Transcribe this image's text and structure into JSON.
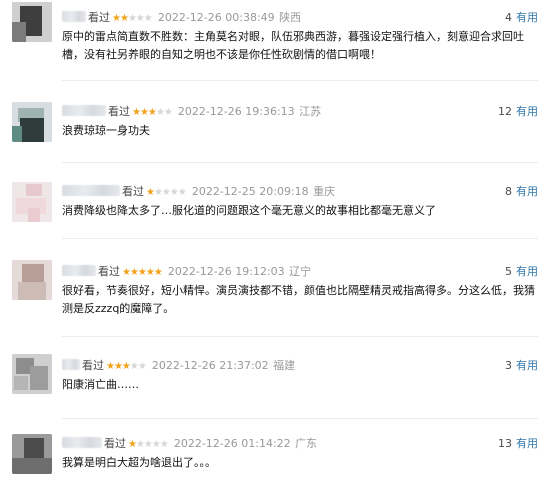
{
  "reviews": [
    {
      "watched": "看过",
      "stars": 2,
      "time": "2022-12-26 00:38:49",
      "location": "陕西",
      "useful_count": "4",
      "useful_label": "有用",
      "content": "原中的雷点简直数不胜数：主角莫名对眼，队伍邪典西游，暮强设定强行植入，刻意迎合求回吐槽，没有社另养眼的自知之明也不该是你任性砍剧情的借口啊喂！"
    },
    {
      "watched": "看过",
      "stars": 3,
      "time": "2022-12-26 19:36:13",
      "location": "江苏",
      "useful_count": "12",
      "useful_label": "有用",
      "content": "浪费琼琼一身功夫"
    },
    {
      "watched": "看过",
      "stars": 1,
      "time": "2022-12-25 20:09:18",
      "location": "重庆",
      "useful_count": "8",
      "useful_label": "有用",
      "content": "消费降级也降太多了…服化道的问题跟这个毫无意义的故事相比都毫无意义了"
    },
    {
      "watched": "看过",
      "stars": 5,
      "time": "2022-12-26 19:12:03",
      "location": "辽宁",
      "useful_count": "5",
      "useful_label": "有用",
      "content": "很好看，节奏很好，短小精悍。演员演技都不错，颜值也比隔壁精灵戒指高得多。分这么低，我猜测是反zzzq的魔障了。"
    },
    {
      "watched": "看过",
      "stars": 3,
      "time": "2022-12-26 21:37:02",
      "location": "福建",
      "useful_count": "3",
      "useful_label": "有用",
      "content": "阳康消亡曲……"
    },
    {
      "watched": "看过",
      "stars": 1,
      "time": "2022-12-26 01:14:22",
      "location": "广东",
      "useful_count": "13",
      "useful_label": "有用",
      "content": "我算是明白大超为啥退出了。。。"
    }
  ]
}
